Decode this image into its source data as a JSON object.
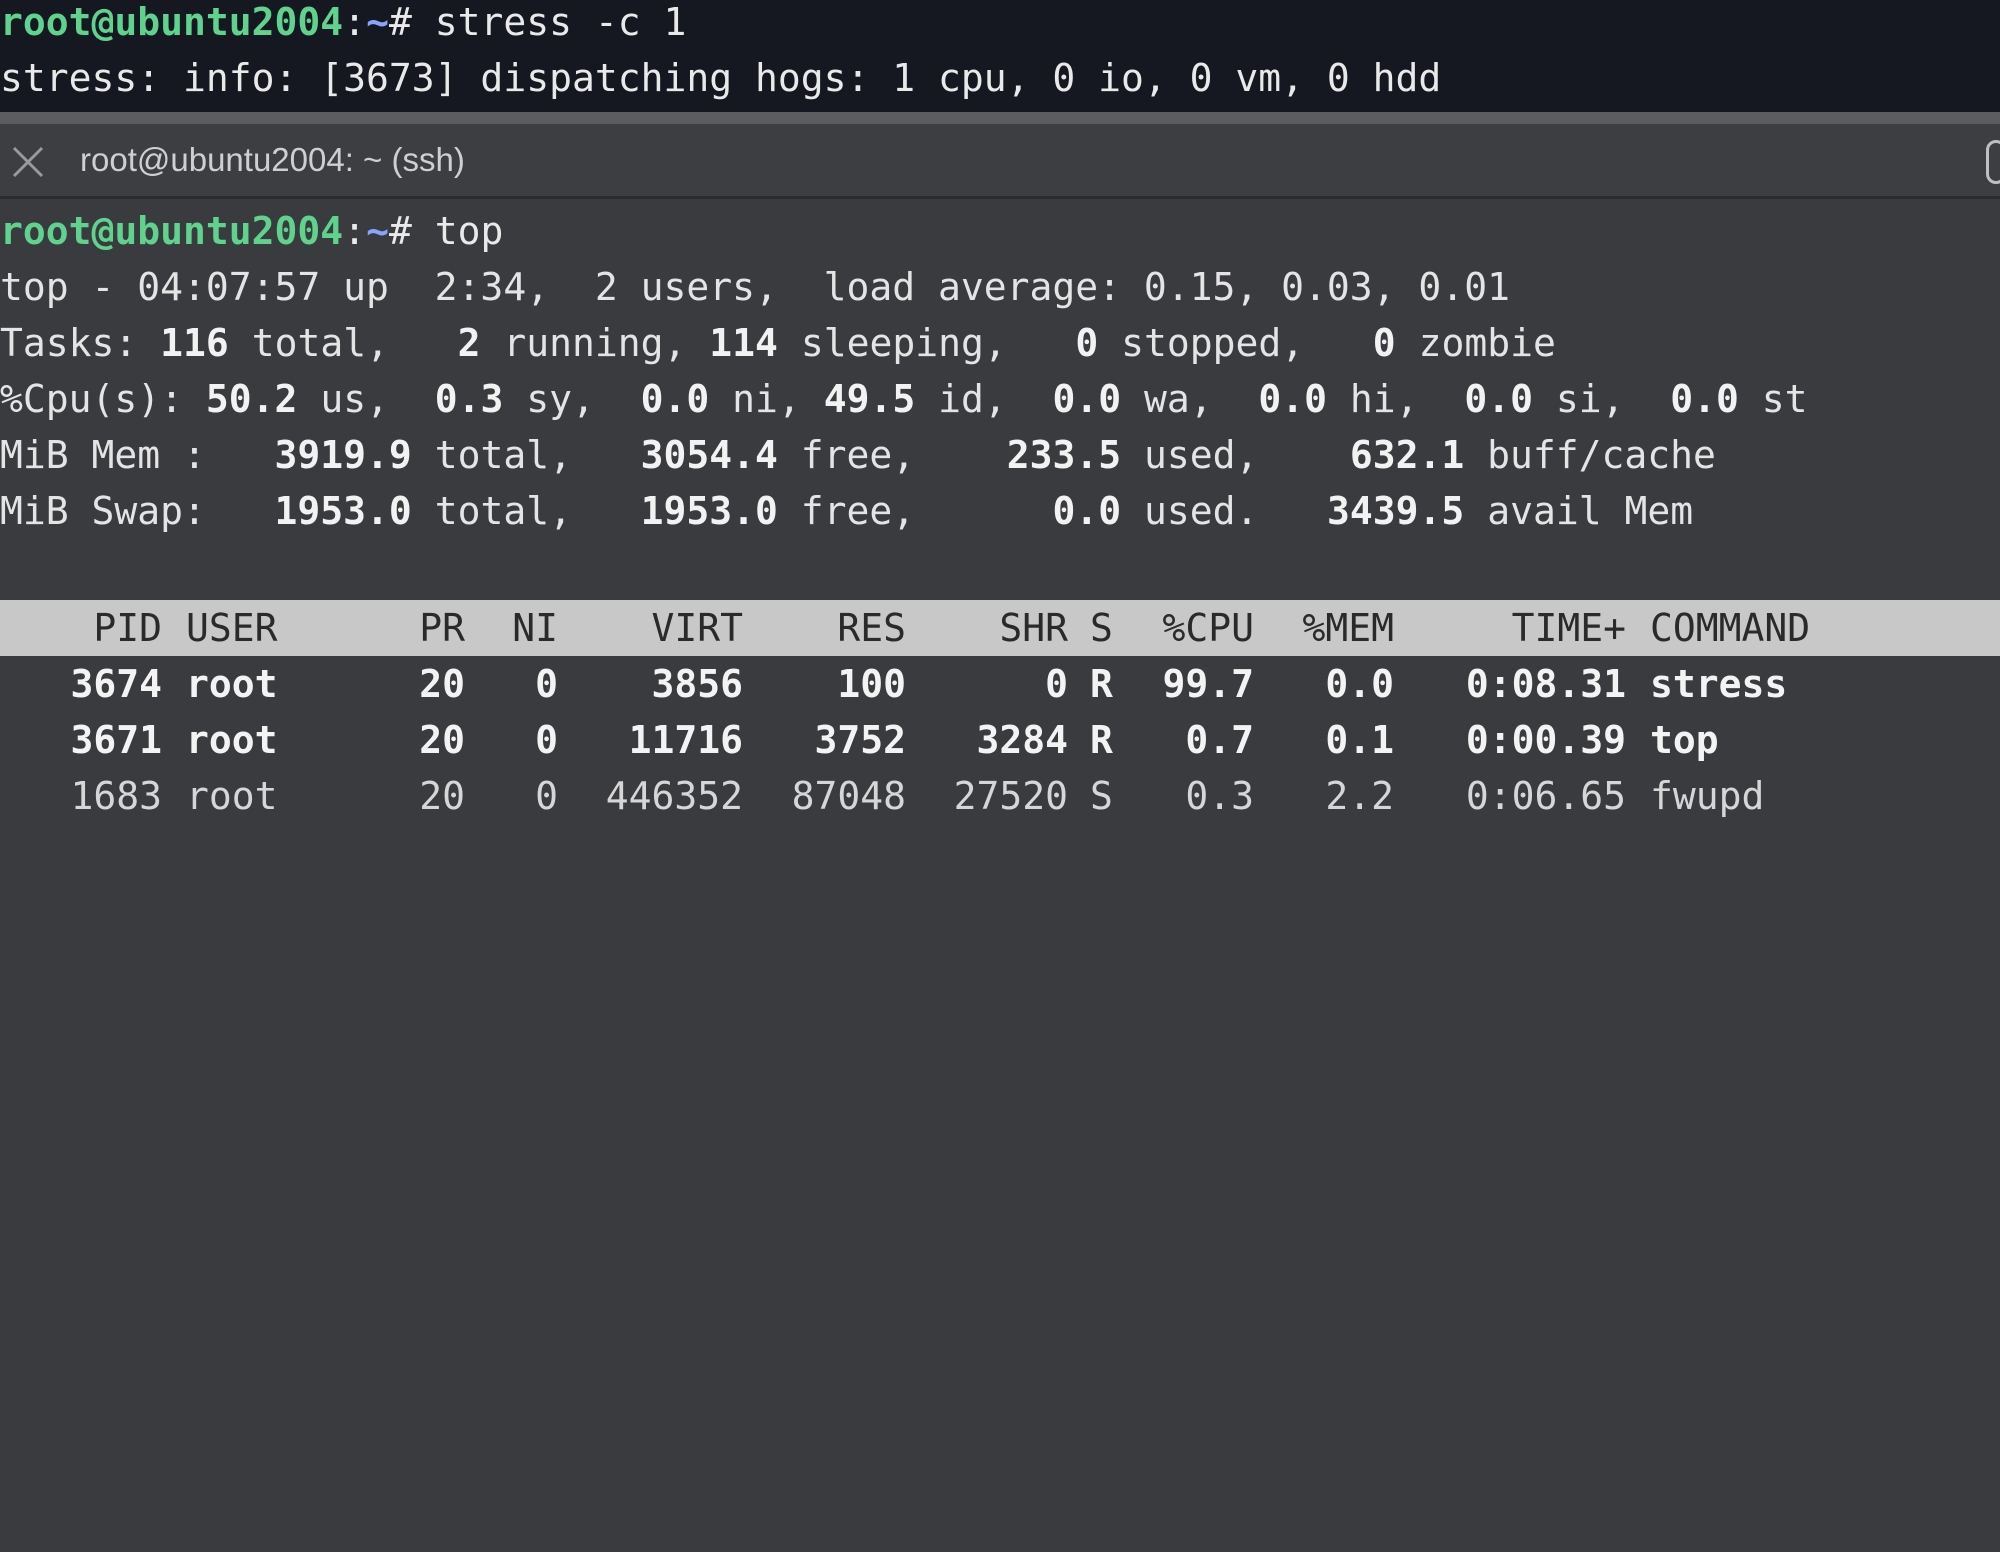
{
  "upper_pane": {
    "prompt_user": "root@ubuntu2004",
    "prompt_sep": ":",
    "prompt_path": "~",
    "prompt_symbol": "#",
    "command": " stress -c 1",
    "output": "stress: info: [3673] dispatching hogs: 1 cpu, 0 io, 0 vm, 0 hdd"
  },
  "tab": {
    "close_icon": "close-icon",
    "title": "root@ubuntu2004: ~ (ssh)"
  },
  "lower_pane": {
    "prompt_user": "root@ubuntu2004",
    "prompt_sep": ":",
    "prompt_path": "~",
    "prompt_symbol": "#",
    "command": " top",
    "top_line": "top - 04:07:57 up  2:34,  2 users,  load average: 0.15, 0.03, 0.01",
    "tasks": {
      "label": "Tasks:",
      "total": "116",
      "total_label": " total,",
      "running": "2",
      "running_label": " running,",
      "sleeping": "114",
      "sleeping_label": " sleeping,",
      "stopped": "0",
      "stopped_label": " stopped,",
      "zombie": "0",
      "zombie_label": " zombie"
    },
    "cpu": {
      "label": "%Cpu(s):",
      "us": "50.2",
      "us_label": " us,",
      "sy": "0.3",
      "sy_label": " sy,",
      "ni": "0.0",
      "ni_label": " ni,",
      "id": "49.5",
      "id_label": " id,",
      "wa": "0.0",
      "wa_label": " wa,",
      "hi": "0.0",
      "hi_label": " hi,",
      "si": "0.0",
      "si_label": " si,",
      "st": "0.0",
      "st_label": " st"
    },
    "mem": {
      "label": "MiB Mem :",
      "total": "3919.9",
      "total_label": " total,",
      "free": "3054.4",
      "free_label": " free,",
      "used": "233.5",
      "used_label": " used,",
      "buff": "632.1",
      "buff_label": " buff/cache"
    },
    "swap": {
      "label": "MiB Swap:",
      "total": "1953.0",
      "total_label": " total,",
      "free": "1953.0",
      "free_label": " free,",
      "used": "0.0",
      "used_label": " used.",
      "avail": "3439.5",
      "avail_label": " avail Mem"
    },
    "table": {
      "headers": {
        "pid": "PID",
        "user": "USER",
        "pr": "PR",
        "ni": "NI",
        "virt": "VIRT",
        "res": "RES",
        "shr": "SHR",
        "s": "S",
        "cpu": "%CPU",
        "mem": "%MEM",
        "time": "TIME+",
        "command": "COMMAND"
      },
      "rows": [
        {
          "pid": "3674",
          "user": "root",
          "pr": "20",
          "ni": "0",
          "virt": "3856",
          "res": "100",
          "shr": "0",
          "s": "R",
          "cpu": "99.7",
          "mem": "0.0",
          "time": "0:08.31",
          "command": "stress"
        },
        {
          "pid": "3671",
          "user": "root",
          "pr": "20",
          "ni": "0",
          "virt": "11716",
          "res": "3752",
          "shr": "3284",
          "s": "R",
          "cpu": "0.7",
          "mem": "0.1",
          "time": "0:00.39",
          "command": "top"
        },
        {
          "pid": "1683",
          "user": "root",
          "pr": "20",
          "ni": "0",
          "virt": "446352",
          "res": "87048",
          "shr": "27520",
          "s": "S",
          "cpu": "0.3",
          "mem": "2.2",
          "time": "0:06.65",
          "command": "fwupd"
        }
      ]
    }
  }
}
